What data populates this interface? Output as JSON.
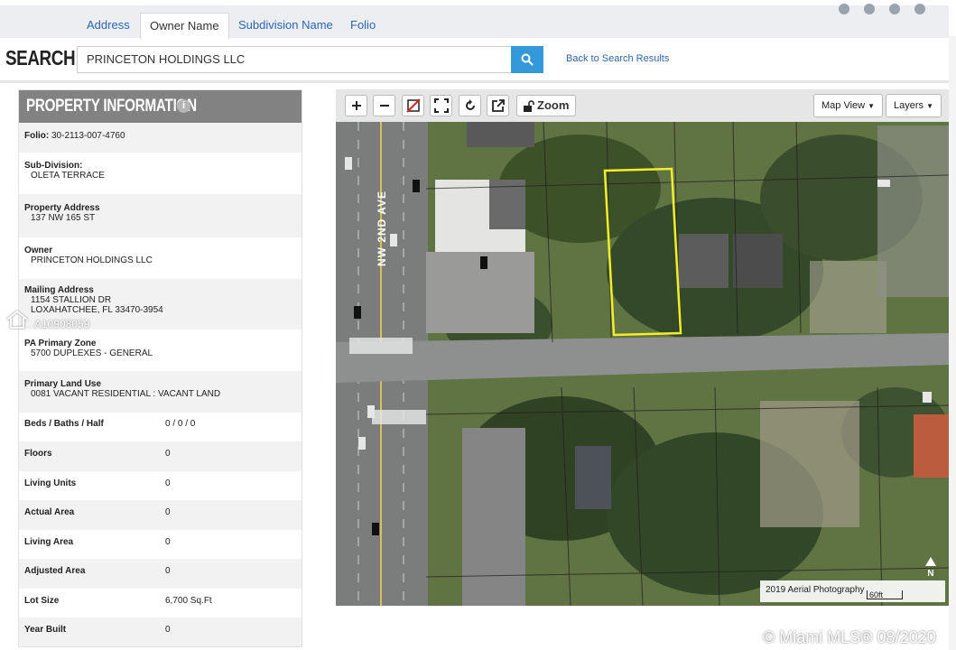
{
  "tabs": [
    {
      "label": "Address",
      "active": false
    },
    {
      "label": "Owner Name",
      "active": true
    },
    {
      "label": "Subdivision Name",
      "active": false
    },
    {
      "label": "Folio",
      "active": false
    }
  ],
  "search": {
    "label": "SEARCH:",
    "value": "PRINCETON HOLDINGS LLC",
    "back_link": "Back to Search Results"
  },
  "property": {
    "title": "PROPERTY INFORMATION",
    "folio_label": "Folio:",
    "folio_value": "30-2113-007-4760",
    "subdivision_label": "Sub-Division:",
    "subdivision_value": "OLETA TERRACE",
    "address_label": "Property Address",
    "address_value": "137 NW 165 ST",
    "owner_label": "Owner",
    "owner_value": "PRINCETON HOLDINGS LLC",
    "mailing_label": "Mailing Address",
    "mailing_line1": "1154 STALLION DR",
    "mailing_line2": "LOXAHATCHEE, FL 33470-3954",
    "zone_label": "PA Primary Zone",
    "zone_value": "5700 DUPLEXES - GENERAL",
    "land_use_label": "Primary Land Use",
    "land_use_value": "0081 VACANT RESIDENTIAL : VACANT LAND",
    "beds_label": "Beds / Baths / Half",
    "beds_value": "0 / 0 / 0",
    "floors_label": "Floors",
    "floors_value": "0",
    "units_label": "Living Units",
    "units_value": "0",
    "actual_area_label": "Actual Area",
    "actual_area_value": "0",
    "living_area_label": "Living Area",
    "living_area_value": "0",
    "adjusted_area_label": "Adjusted Area",
    "adjusted_area_value": "0",
    "lot_size_label": "Lot Size",
    "lot_size_value": "6,700 Sq.Ft",
    "year_built_label": "Year Built",
    "year_built_value": "0"
  },
  "watermark_id": "A10908059",
  "map": {
    "zoom_label": "Zoom",
    "map_view_label": "Map View",
    "layers_label": "Layers",
    "street_label": "NW 2ND AVE",
    "imagery_label": "2019 Aerial Photography",
    "scale_label": "60ft",
    "north_label": "N"
  },
  "copyright": "© Miami MLS® 08/2020",
  "colors": {
    "accent_blue": "#3399d8",
    "link_blue": "#2a67b1",
    "panel_header": "#828282",
    "parcel_outline": "#f4ee2a"
  }
}
